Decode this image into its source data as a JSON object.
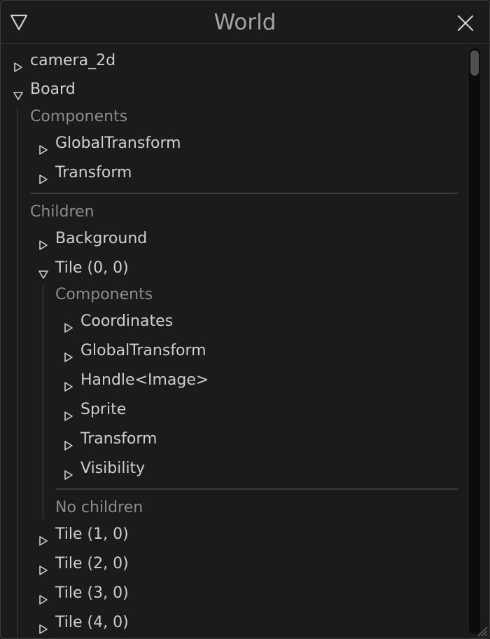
{
  "window": {
    "title": "World",
    "icons": {
      "collapse": "triangle-down-icon",
      "close": "close-icon",
      "resize": "resize-grip-icon"
    }
  },
  "tree": {
    "camera_2d": "camera_2d",
    "board": {
      "label": "Board",
      "components_heading": "Components",
      "components": [
        "GlobalTransform",
        "Transform"
      ],
      "children_heading": "Children",
      "background": "Background",
      "tile_0_0": {
        "label": "Tile (0, 0)",
        "components_heading": "Components",
        "components": [
          "Coordinates",
          "GlobalTransform",
          "Handle<Image>",
          "Sprite",
          "Transform",
          "Visibility"
        ],
        "no_children": "No children"
      },
      "more_tiles": [
        "Tile (1, 0)",
        "Tile (2, 0)",
        "Tile (3, 0)",
        "Tile (4, 0)"
      ]
    }
  },
  "colors": {
    "background": "#1b1b1b",
    "text": "#cfcfcf",
    "section_heading": "#8c8c8c",
    "title": "#a3a3a3"
  }
}
